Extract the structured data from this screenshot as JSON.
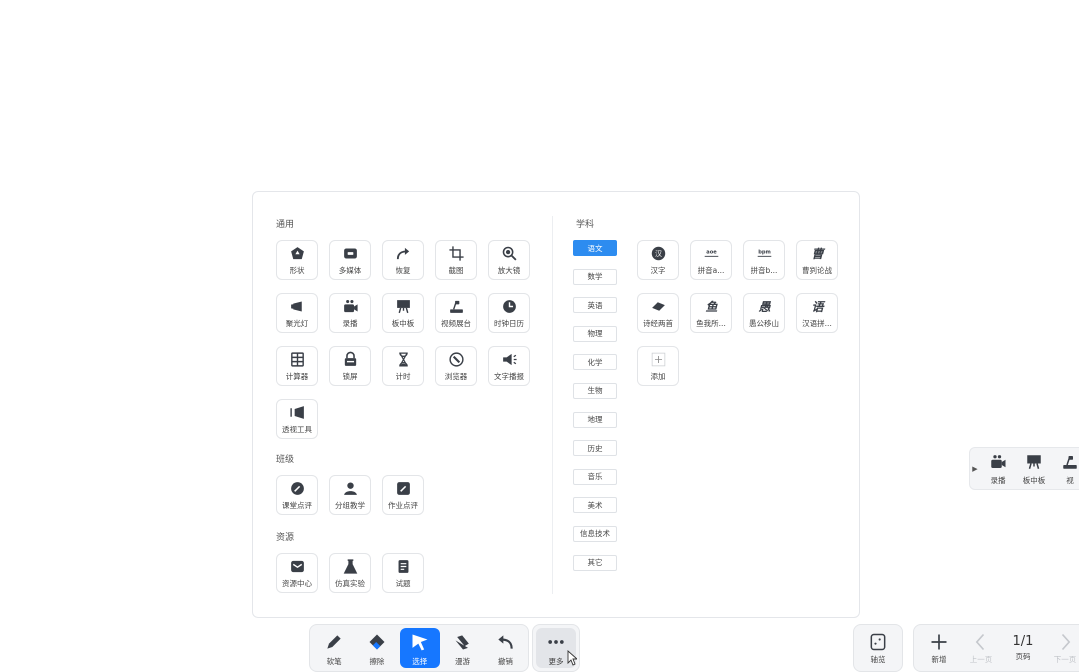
{
  "panel": {
    "general": {
      "title": "通用",
      "items": [
        {
          "label": "形状",
          "icon": "shape-icon"
        },
        {
          "label": "多媒体",
          "icon": "video-icon"
        },
        {
          "label": "恢复",
          "icon": "redo-icon"
        },
        {
          "label": "截图",
          "icon": "crop-icon"
        },
        {
          "label": "放大镜",
          "icon": "magnifier-icon"
        },
        {
          "label": "聚光灯",
          "icon": "spotlight-icon"
        },
        {
          "label": "录播",
          "icon": "record-icon"
        },
        {
          "label": "板中板",
          "icon": "board-icon"
        },
        {
          "label": "视频展台",
          "icon": "visualizer-icon"
        },
        {
          "label": "时钟日历",
          "icon": "clock-icon"
        },
        {
          "label": "计算器",
          "icon": "calculator-icon"
        },
        {
          "label": "锁屏",
          "icon": "lock-icon"
        },
        {
          "label": "计时",
          "icon": "hourglass-icon"
        },
        {
          "label": "浏览器",
          "icon": "compass-icon"
        },
        {
          "label": "文字播报",
          "icon": "speaker-icon"
        },
        {
          "label": "透视工具",
          "icon": "perspective-icon"
        }
      ]
    },
    "class": {
      "title": "班级",
      "items": [
        {
          "label": "课堂点评",
          "icon": "comment-icon"
        },
        {
          "label": "分组教学",
          "icon": "group-icon"
        },
        {
          "label": "作业点评",
          "icon": "homework-icon"
        }
      ]
    },
    "resources": {
      "title": "资源",
      "items": [
        {
          "label": "资源中心",
          "icon": "inbox-icon"
        },
        {
          "label": "仿真实验",
          "icon": "flask-icon"
        },
        {
          "label": "试题",
          "icon": "document-icon"
        }
      ]
    },
    "subjects": {
      "title": "学科",
      "list": [
        "语文",
        "数学",
        "英语",
        "物理",
        "化学",
        "生物",
        "地理",
        "历史",
        "音乐",
        "美术",
        "信息技术",
        "其它"
      ],
      "active_index": 0,
      "tools": [
        {
          "label": "汉字",
          "icon": "hanzi-icon",
          "glyph": "汉"
        },
        {
          "label": "拼音a...",
          "icon": "pinyin-aoe-icon",
          "glyph": "aoe"
        },
        {
          "label": "拼音b...",
          "icon": "pinyin-bpm-icon",
          "glyph": "bpm"
        },
        {
          "label": "曹刿论战",
          "icon": "cao-icon",
          "glyph": "曹"
        },
        {
          "label": "诗经两首",
          "icon": "poetry-icon",
          "glyph": ""
        },
        {
          "label": "鱼我所...",
          "icon": "fish-icon",
          "glyph": "鱼"
        },
        {
          "label": "愚公移山",
          "icon": "yugong-icon",
          "glyph": "愚"
        },
        {
          "label": "汉语拼...",
          "icon": "pinyin-table-icon",
          "glyph": "语"
        },
        {
          "label": "添加",
          "icon": "plus-icon",
          "glyph": ""
        }
      ]
    }
  },
  "mini_toolbar": {
    "items": [
      {
        "label": "录播",
        "icon": "record-icon"
      },
      {
        "label": "板中板",
        "icon": "board-icon"
      },
      {
        "label": "视",
        "icon": "visualizer-icon"
      }
    ]
  },
  "toolbar": {
    "tools": [
      {
        "label": "软笔",
        "icon": "pen-icon"
      },
      {
        "label": "擦除",
        "icon": "eraser-icon"
      },
      {
        "label": "选择",
        "icon": "select-icon"
      },
      {
        "label": "漫游",
        "icon": "hand-icon"
      },
      {
        "label": "撤销",
        "icon": "undo-icon"
      }
    ],
    "active_index": 2,
    "more_label": "更多"
  },
  "page_controls": {
    "thumbnail_label": "轴览",
    "add_label": "新增",
    "prev_label": "上一页",
    "page_label": "页码",
    "page_value": "1/1",
    "next_label": "下一页"
  },
  "colors": {
    "accent": "#1677ff",
    "subject_active": "#2d8cf0",
    "icon": "#3a3f47"
  }
}
